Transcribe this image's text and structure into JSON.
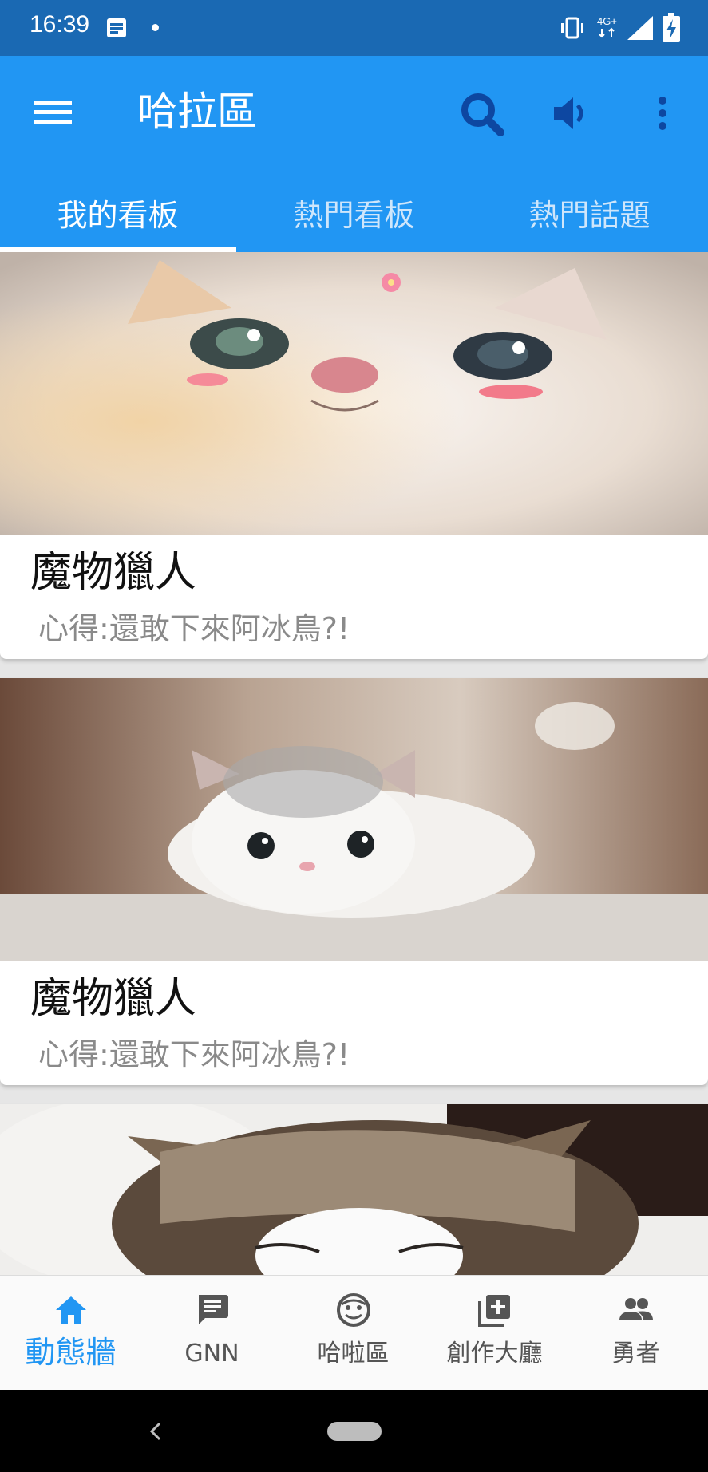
{
  "status_bar": {
    "time": "16:39",
    "network": "4G+"
  },
  "app_bar": {
    "title": "哈拉區",
    "icons": [
      "menu-icon",
      "search-icon",
      "volume-icon",
      "more-vert-icon"
    ]
  },
  "tabs": [
    {
      "label": "我的看板",
      "active": true
    },
    {
      "label": "熱門看板",
      "active": false
    },
    {
      "label": "熱門話題",
      "active": false
    }
  ],
  "feed": {
    "cards": [
      {
        "title": "魔物獵人",
        "subtitle": "心得:還敢下來阿冰鳥?!",
        "image": "cat-closeup-photo"
      },
      {
        "title": "魔物獵人",
        "subtitle": "心得:還敢下來阿冰鳥?!",
        "image": "white-kitten-photo"
      },
      {
        "title": "",
        "subtitle": "",
        "image": "sleeping-tabby-cat-photo"
      }
    ]
  },
  "bottom_nav": {
    "items": [
      {
        "label": "動態牆",
        "icon": "home-icon",
        "active": true
      },
      {
        "label": "GNN",
        "icon": "message-icon",
        "active": false
      },
      {
        "label": "哈啦區",
        "icon": "face-icon",
        "active": false
      },
      {
        "label": "創作大廳",
        "icon": "add-box-icon",
        "active": false
      },
      {
        "label": "勇者",
        "icon": "people-icon",
        "active": false
      }
    ]
  },
  "colors": {
    "status_bar": "#1a69b3",
    "primary": "#2196f3",
    "active_nav": "#2196f3",
    "text_secondary": "#8a8a8a"
  }
}
